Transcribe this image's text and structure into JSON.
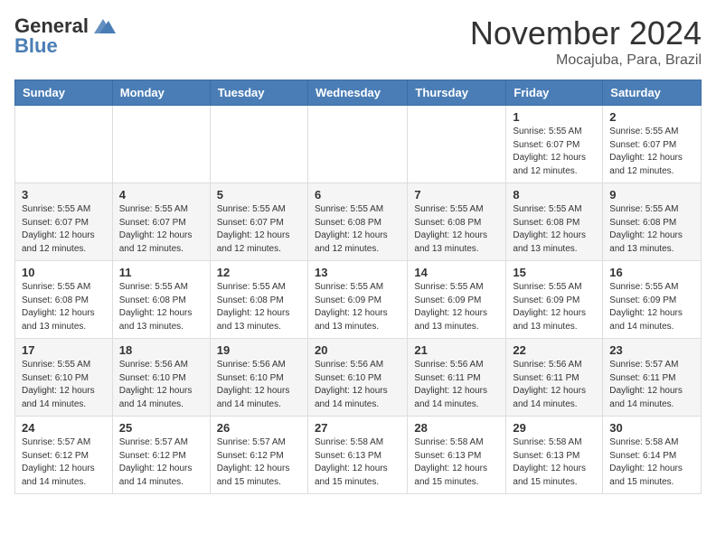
{
  "header": {
    "logo_general": "General",
    "logo_blue": "Blue",
    "month_title": "November 2024",
    "location": "Mocajuba, Para, Brazil"
  },
  "weekdays": [
    "Sunday",
    "Monday",
    "Tuesday",
    "Wednesday",
    "Thursday",
    "Friday",
    "Saturday"
  ],
  "weeks": [
    [
      {
        "day": "",
        "info": ""
      },
      {
        "day": "",
        "info": ""
      },
      {
        "day": "",
        "info": ""
      },
      {
        "day": "",
        "info": ""
      },
      {
        "day": "",
        "info": ""
      },
      {
        "day": "1",
        "info": "Sunrise: 5:55 AM\nSunset: 6:07 PM\nDaylight: 12 hours\nand 12 minutes."
      },
      {
        "day": "2",
        "info": "Sunrise: 5:55 AM\nSunset: 6:07 PM\nDaylight: 12 hours\nand 12 minutes."
      }
    ],
    [
      {
        "day": "3",
        "info": "Sunrise: 5:55 AM\nSunset: 6:07 PM\nDaylight: 12 hours\nand 12 minutes."
      },
      {
        "day": "4",
        "info": "Sunrise: 5:55 AM\nSunset: 6:07 PM\nDaylight: 12 hours\nand 12 minutes."
      },
      {
        "day": "5",
        "info": "Sunrise: 5:55 AM\nSunset: 6:07 PM\nDaylight: 12 hours\nand 12 minutes."
      },
      {
        "day": "6",
        "info": "Sunrise: 5:55 AM\nSunset: 6:08 PM\nDaylight: 12 hours\nand 12 minutes."
      },
      {
        "day": "7",
        "info": "Sunrise: 5:55 AM\nSunset: 6:08 PM\nDaylight: 12 hours\nand 13 minutes."
      },
      {
        "day": "8",
        "info": "Sunrise: 5:55 AM\nSunset: 6:08 PM\nDaylight: 12 hours\nand 13 minutes."
      },
      {
        "day": "9",
        "info": "Sunrise: 5:55 AM\nSunset: 6:08 PM\nDaylight: 12 hours\nand 13 minutes."
      }
    ],
    [
      {
        "day": "10",
        "info": "Sunrise: 5:55 AM\nSunset: 6:08 PM\nDaylight: 12 hours\nand 13 minutes."
      },
      {
        "day": "11",
        "info": "Sunrise: 5:55 AM\nSunset: 6:08 PM\nDaylight: 12 hours\nand 13 minutes."
      },
      {
        "day": "12",
        "info": "Sunrise: 5:55 AM\nSunset: 6:08 PM\nDaylight: 12 hours\nand 13 minutes."
      },
      {
        "day": "13",
        "info": "Sunrise: 5:55 AM\nSunset: 6:09 PM\nDaylight: 12 hours\nand 13 minutes."
      },
      {
        "day": "14",
        "info": "Sunrise: 5:55 AM\nSunset: 6:09 PM\nDaylight: 12 hours\nand 13 minutes."
      },
      {
        "day": "15",
        "info": "Sunrise: 5:55 AM\nSunset: 6:09 PM\nDaylight: 12 hours\nand 13 minutes."
      },
      {
        "day": "16",
        "info": "Sunrise: 5:55 AM\nSunset: 6:09 PM\nDaylight: 12 hours\nand 14 minutes."
      }
    ],
    [
      {
        "day": "17",
        "info": "Sunrise: 5:55 AM\nSunset: 6:10 PM\nDaylight: 12 hours\nand 14 minutes."
      },
      {
        "day": "18",
        "info": "Sunrise: 5:56 AM\nSunset: 6:10 PM\nDaylight: 12 hours\nand 14 minutes."
      },
      {
        "day": "19",
        "info": "Sunrise: 5:56 AM\nSunset: 6:10 PM\nDaylight: 12 hours\nand 14 minutes."
      },
      {
        "day": "20",
        "info": "Sunrise: 5:56 AM\nSunset: 6:10 PM\nDaylight: 12 hours\nand 14 minutes."
      },
      {
        "day": "21",
        "info": "Sunrise: 5:56 AM\nSunset: 6:11 PM\nDaylight: 12 hours\nand 14 minutes."
      },
      {
        "day": "22",
        "info": "Sunrise: 5:56 AM\nSunset: 6:11 PM\nDaylight: 12 hours\nand 14 minutes."
      },
      {
        "day": "23",
        "info": "Sunrise: 5:57 AM\nSunset: 6:11 PM\nDaylight: 12 hours\nand 14 minutes."
      }
    ],
    [
      {
        "day": "24",
        "info": "Sunrise: 5:57 AM\nSunset: 6:12 PM\nDaylight: 12 hours\nand 14 minutes."
      },
      {
        "day": "25",
        "info": "Sunrise: 5:57 AM\nSunset: 6:12 PM\nDaylight: 12 hours\nand 14 minutes."
      },
      {
        "day": "26",
        "info": "Sunrise: 5:57 AM\nSunset: 6:12 PM\nDaylight: 12 hours\nand 15 minutes."
      },
      {
        "day": "27",
        "info": "Sunrise: 5:58 AM\nSunset: 6:13 PM\nDaylight: 12 hours\nand 15 minutes."
      },
      {
        "day": "28",
        "info": "Sunrise: 5:58 AM\nSunset: 6:13 PM\nDaylight: 12 hours\nand 15 minutes."
      },
      {
        "day": "29",
        "info": "Sunrise: 5:58 AM\nSunset: 6:13 PM\nDaylight: 12 hours\nand 15 minutes."
      },
      {
        "day": "30",
        "info": "Sunrise: 5:58 AM\nSunset: 6:14 PM\nDaylight: 12 hours\nand 15 minutes."
      }
    ]
  ]
}
